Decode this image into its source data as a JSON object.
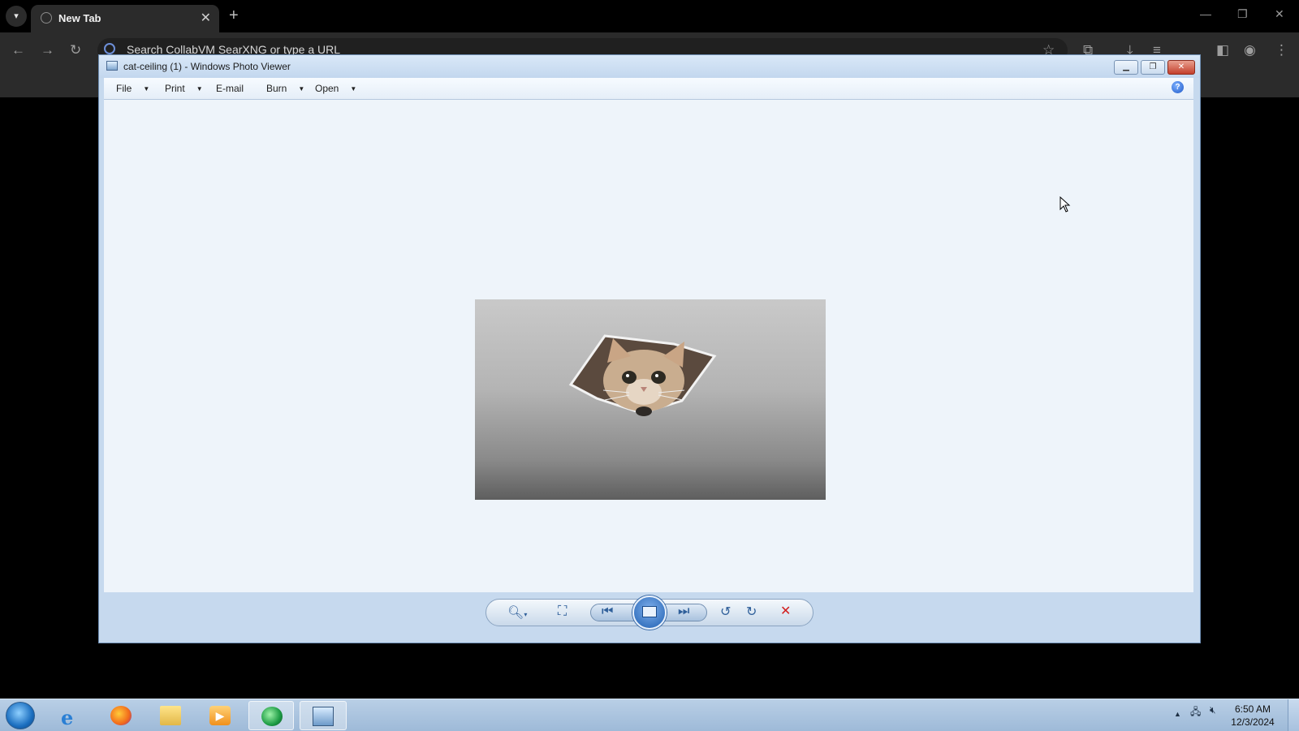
{
  "browser": {
    "tab_title": "New Tab",
    "tab_close": "✕",
    "new_tab": "+",
    "omnibox_text": "Search CollabVM SearXNG or type a URL",
    "icons": [
      "back-icon",
      "forward-icon",
      "reload-icon",
      "bookmark-star-icon",
      "extensions-icon",
      "download-icon",
      "reading-list-icon",
      "side-panel-icon",
      "profile-icon",
      "menu-icon"
    ]
  },
  "photo_viewer": {
    "title": "cat-ceiling (1) - Windows Photo Viewer",
    "menu": {
      "file": "File",
      "print": "Print",
      "email": "E-mail",
      "burn": "Burn",
      "open": "Open"
    },
    "help": "?",
    "image_name": "cat-ceiling (1)"
  },
  "taskbar": {
    "time": "6:50 AM",
    "date": "12/3/2024",
    "apps": [
      "start",
      "internet-explorer",
      "firefox",
      "file-explorer",
      "media-player",
      "collabvm-app",
      "photo-viewer"
    ]
  },
  "colors": {
    "browser_bg": "#000000",
    "toolbar_bg": "#2b2b2b",
    "viewer_canvas": "#eef4fa",
    "viewer_frame": "#c6d9ee",
    "delete_red": "#d21f1f"
  }
}
